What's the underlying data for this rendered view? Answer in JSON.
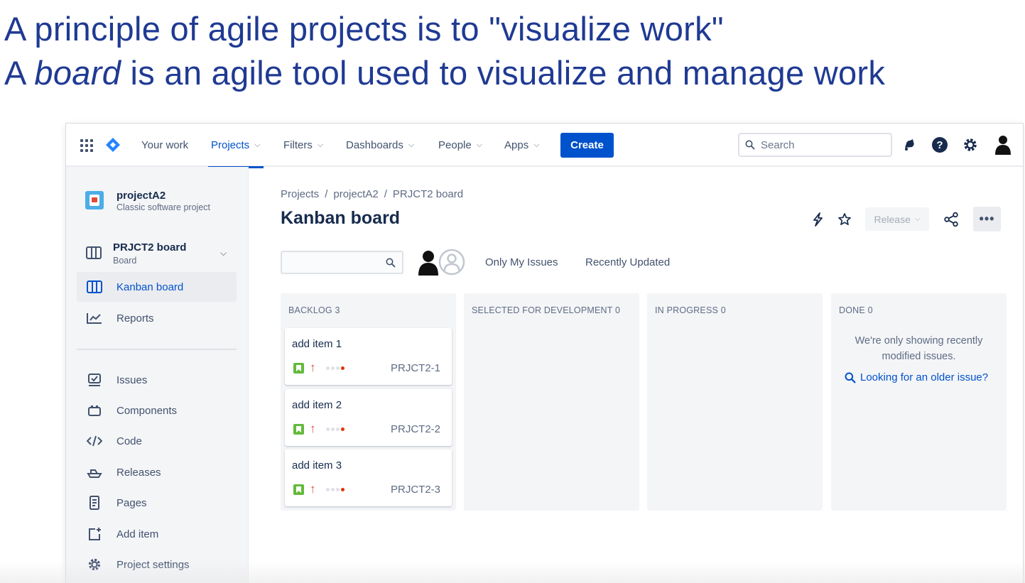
{
  "slide": {
    "line1": "A principle of agile projects is to \"visualize work\"",
    "line2_pre": "A ",
    "line2_em": "board",
    "line2_post": " is an agile tool used to visualize and manage work"
  },
  "topnav": {
    "items": [
      {
        "label": "Your work",
        "dropdown": false
      },
      {
        "label": "Projects",
        "dropdown": true,
        "active": true
      },
      {
        "label": "Filters",
        "dropdown": true
      },
      {
        "label": "Dashboards",
        "dropdown": true
      },
      {
        "label": "People",
        "dropdown": true
      },
      {
        "label": "Apps",
        "dropdown": true
      }
    ],
    "create_label": "Create",
    "search_placeholder": "Search",
    "icons": [
      "notifications-icon",
      "help-icon",
      "settings-icon",
      "profile-icon"
    ]
  },
  "sidebar": {
    "project_name": "projectA2",
    "project_type": "Classic software project",
    "board_name": "PRJCT2 board",
    "board_sub": "Board",
    "items": [
      {
        "label": "Kanban board",
        "icon": "board-icon",
        "selected": true
      },
      {
        "label": "Reports",
        "icon": "reports-icon"
      },
      {
        "label": "Issues",
        "icon": "issues-icon"
      },
      {
        "label": "Components",
        "icon": "components-icon"
      },
      {
        "label": "Code",
        "icon": "code-icon"
      },
      {
        "label": "Releases",
        "icon": "releases-icon"
      },
      {
        "label": "Pages",
        "icon": "pages-icon"
      },
      {
        "label": "Add item",
        "icon": "add-item-icon"
      },
      {
        "label": "Project settings",
        "icon": "settings-icon"
      }
    ]
  },
  "main": {
    "breadcrumb": [
      "Projects",
      "projectA2",
      "PRJCT2 board"
    ],
    "breadcrumb_sep": "/",
    "title": "Kanban board",
    "release_label": "Release",
    "more_label": "•••",
    "filters": [
      "Only My Issues",
      "Recently Updated"
    ]
  },
  "board": {
    "columns": [
      {
        "title": "BACKLOG 3",
        "cards": [
          {
            "summary": "add item 1",
            "key": "PRJCT2-1"
          },
          {
            "summary": "add item 2",
            "key": "PRJCT2-2"
          },
          {
            "summary": "add item 3",
            "key": "PRJCT2-3"
          }
        ]
      },
      {
        "title": "SELECTED FOR DEVELOPMENT 0",
        "cards": []
      },
      {
        "title": "IN PROGRESS 0",
        "cards": []
      },
      {
        "title": "DONE 0",
        "cards": []
      }
    ],
    "done_message": "We're only showing recently modified issues.",
    "done_link": "Looking for an older issue?"
  },
  "colors": {
    "brand": "#0052cc",
    "slide_title": "#1f3a93",
    "story": "#63ba3c",
    "priority_high": "#e5493a"
  }
}
